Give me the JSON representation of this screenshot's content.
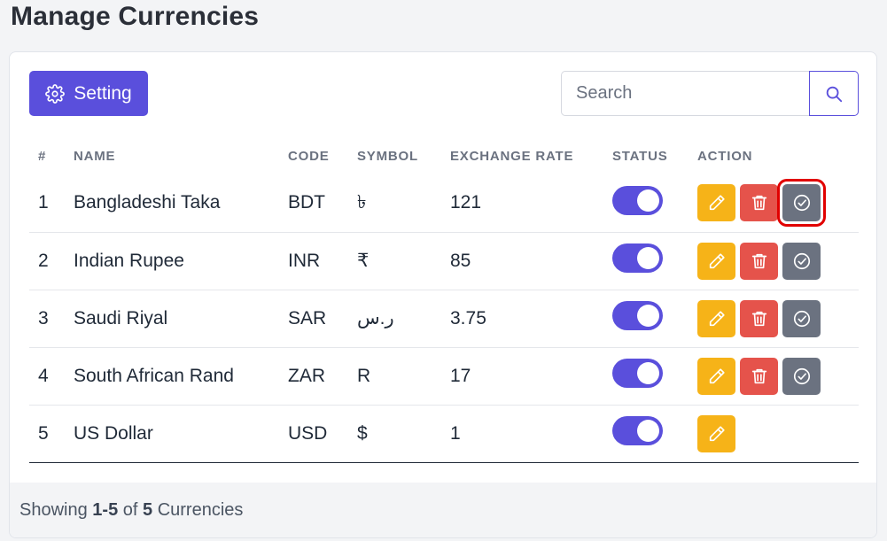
{
  "page": {
    "title": "Manage Currencies"
  },
  "toolbar": {
    "setting_label": "Setting"
  },
  "search": {
    "placeholder": "Search",
    "value": ""
  },
  "table": {
    "headers": {
      "num": "#",
      "name": "NAME",
      "code": "CODE",
      "symbol": "SYMBOL",
      "rate": "EXCHANGE RATE",
      "status": "STATUS",
      "action": "ACTION"
    },
    "rows": [
      {
        "num": "1",
        "name": "Bangladeshi Taka",
        "code": "BDT",
        "symbol": "৳",
        "rate": "121",
        "status_on": true,
        "actions": [
          "edit",
          "delete",
          "default"
        ]
      },
      {
        "num": "2",
        "name": "Indian Rupee",
        "code": "INR",
        "symbol": "₹",
        "rate": "85",
        "status_on": true,
        "actions": [
          "edit",
          "delete",
          "default"
        ]
      },
      {
        "num": "3",
        "name": "Saudi Riyal",
        "code": "SAR",
        "symbol": "ر.س",
        "rate": "3.75",
        "status_on": true,
        "actions": [
          "edit",
          "delete",
          "default"
        ]
      },
      {
        "num": "4",
        "name": "South African Rand",
        "code": "ZAR",
        "symbol": "R",
        "rate": "17",
        "status_on": true,
        "actions": [
          "edit",
          "delete",
          "default"
        ]
      },
      {
        "num": "5",
        "name": "US Dollar",
        "code": "USD",
        "symbol": "$",
        "rate": "1",
        "status_on": true,
        "actions": [
          "edit"
        ]
      }
    ]
  },
  "footer": {
    "prefix": "Showing",
    "range": "1-5",
    "of": "of",
    "total": "5",
    "suffix": "Currencies"
  },
  "icons": {
    "setting": "gear-icon",
    "search": "search-icon",
    "edit": "pencil-icon",
    "delete": "trash-icon",
    "default": "check-circle-icon"
  },
  "colors": {
    "primary": "#5a4fdc",
    "edit": "#f6b318",
    "delete": "#e5534b",
    "default": "#6b7280",
    "highlight": "#e10000"
  }
}
